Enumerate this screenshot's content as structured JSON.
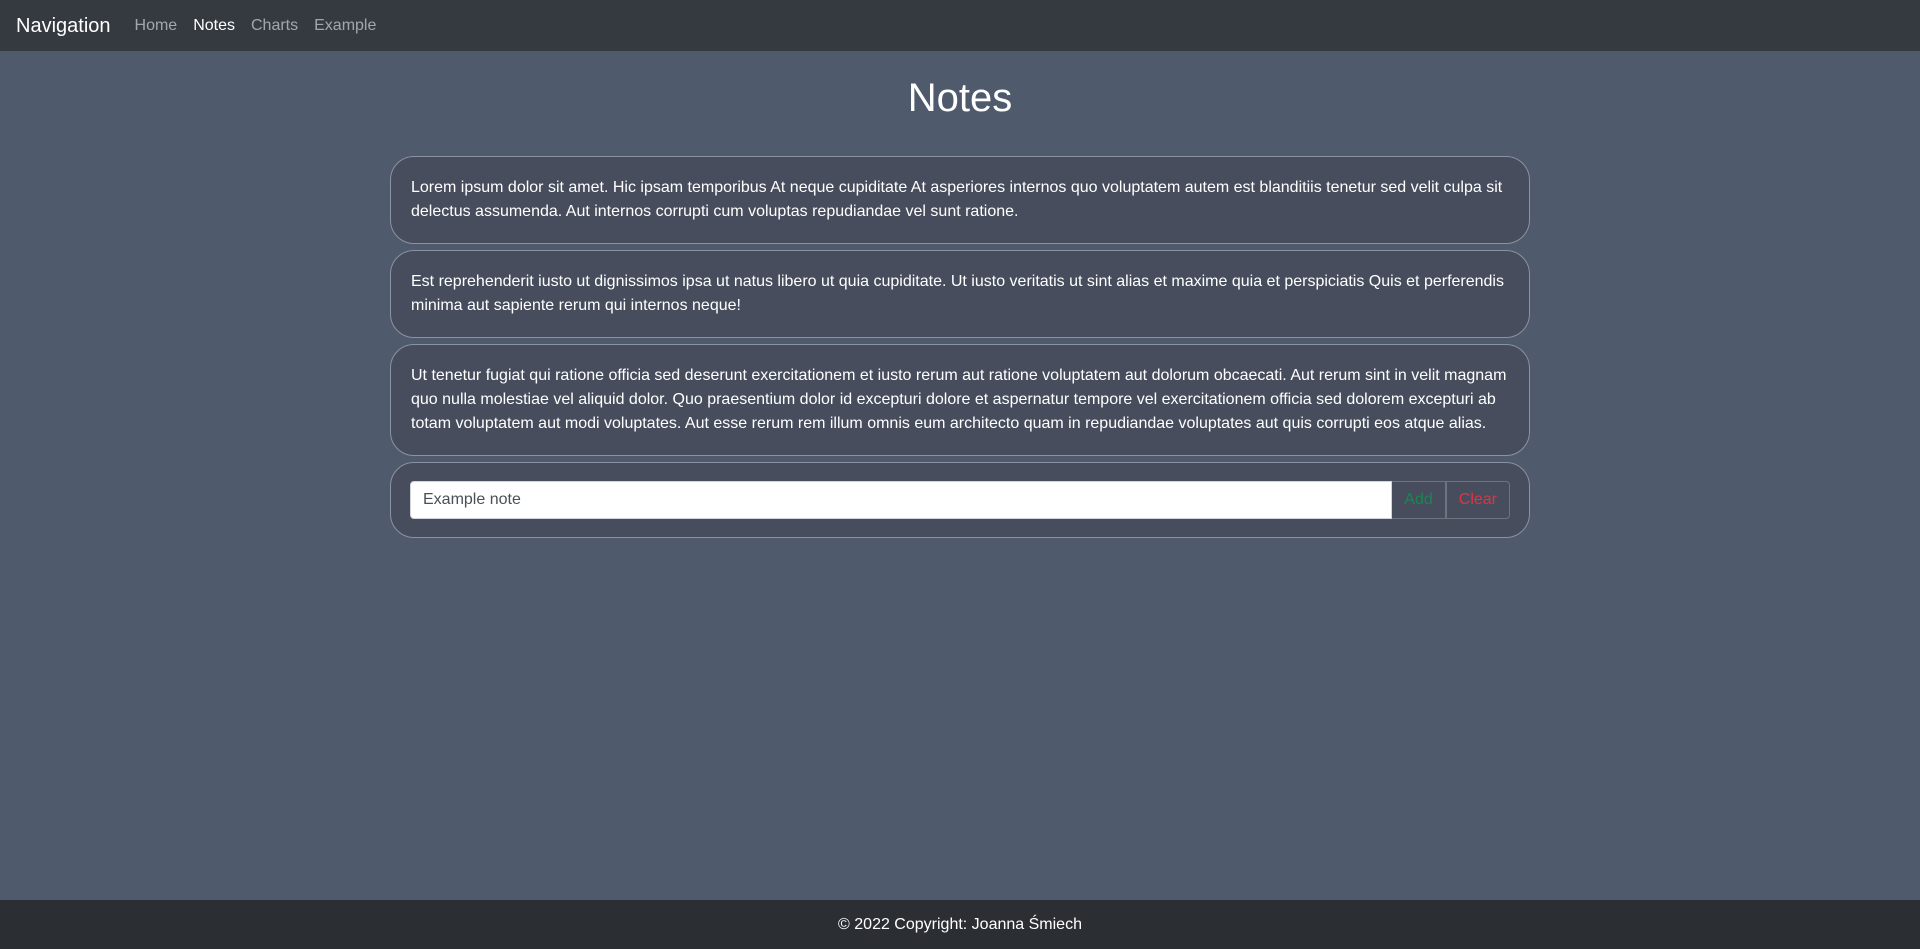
{
  "navbar": {
    "brand": "Navigation",
    "links": [
      {
        "label": "Home",
        "active": false
      },
      {
        "label": "Notes",
        "active": true
      },
      {
        "label": "Charts",
        "active": false
      },
      {
        "label": "Example",
        "active": false
      }
    ]
  },
  "main": {
    "title": "Notes",
    "notes": [
      "Lorem ipsum dolor sit amet. Hic ipsam temporibus At neque cupiditate At asperiores internos quo voluptatem autem est blanditiis tenetur sed velit culpa sit delectus assumenda. Aut internos corrupti cum voluptas repudiandae vel sunt ratione.",
      "Est reprehenderit iusto ut dignissimos ipsa ut natus libero ut quia cupiditate. Ut iusto veritatis ut sint alias et maxime quia et perspiciatis Quis et perferendis minima aut sapiente rerum qui internos neque!",
      "Ut tenetur fugiat qui ratione officia sed deserunt exercitationem et iusto rerum aut ratione voluptatem aut dolorum obcaecati. Aut rerum sint in velit magnam quo nulla molestiae vel aliquid dolor. Quo praesentium dolor id excepturi dolore et aspernatur tempore vel exercitationem officia sed dolorem excepturi ab totam voluptatem aut modi voluptates. Aut esse rerum rem illum omnis eum architecto quam in repudiandae voluptates aut quis corrupti eos atque alias."
    ],
    "input": {
      "placeholder": "Example note",
      "value": ""
    },
    "add_label": "Add",
    "clear_label": "Clear"
  },
  "footer": {
    "text": "© 2022 Copyright: Joanna Śmiech"
  },
  "colors": {
    "background": "#4f5a6c",
    "navbar": "#343a40",
    "card": "#474d5c",
    "add": "#198754",
    "clear": "#dc3545",
    "footer": "#2b2f33"
  }
}
